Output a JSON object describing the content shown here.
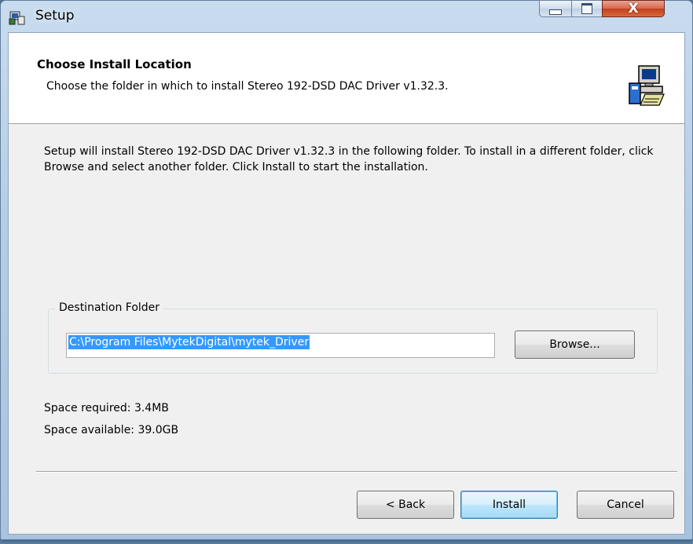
{
  "window": {
    "title": "Setup",
    "controls": {
      "minimize": "minimize",
      "maximize": "maximize",
      "close": "X"
    }
  },
  "header": {
    "title": "Choose Install Location",
    "subtitle": "Choose the folder in which to install Stereo 192-DSD DAC Driver v1.32.3."
  },
  "body": {
    "intro": "Setup will install Stereo 192-DSD DAC Driver v1.32.3 in the following folder. To install in a different folder, click Browse and select another folder. Click Install to start the installation."
  },
  "destination": {
    "legend": "Destination Folder",
    "path": "C:\\Program Files\\MytekDigital\\mytek_Driver",
    "browse_label": "Browse..."
  },
  "space": {
    "required": "Space required: 3.4MB",
    "available": "Space available: 39.0GB"
  },
  "buttons": {
    "back": "< Back",
    "install": "Install",
    "cancel": "Cancel"
  },
  "icons": {
    "app": "installer-app-icon",
    "header": "installer-computer-icon"
  }
}
